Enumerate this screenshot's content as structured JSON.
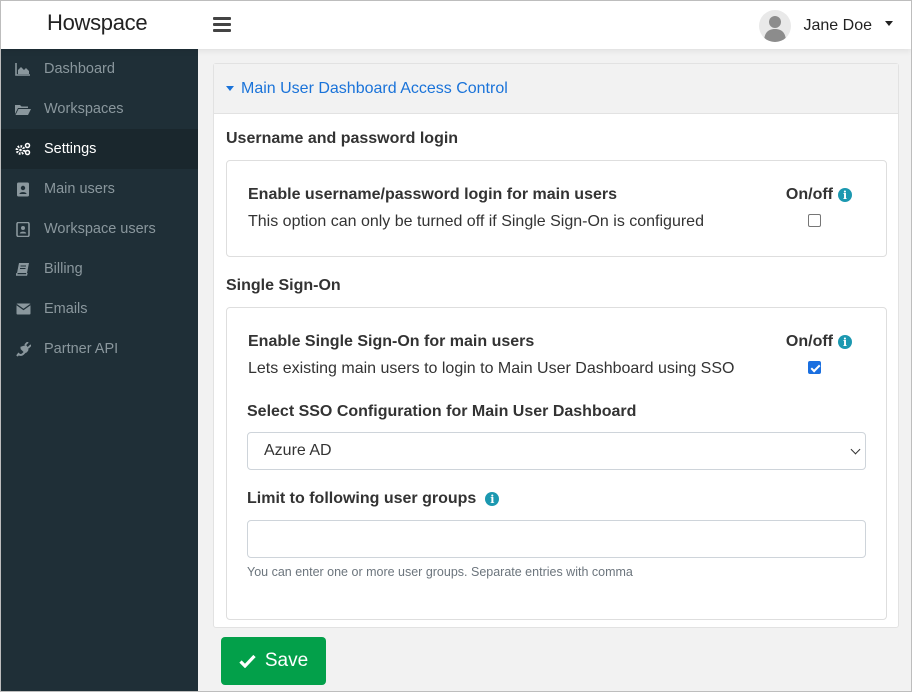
{
  "app": {
    "logo": "Howspace"
  },
  "header": {
    "user_name": "Jane Doe"
  },
  "sidebar": {
    "items": [
      {
        "label": "Dashboard",
        "icon": "area-chart-icon",
        "active": false
      },
      {
        "label": "Workspaces",
        "icon": "folder-open-icon",
        "active": false
      },
      {
        "label": "Settings",
        "icon": "cogs-icon",
        "active": true
      },
      {
        "label": "Main users",
        "icon": "address-book-icon",
        "active": false
      },
      {
        "label": "Workspace users",
        "icon": "address-card-icon",
        "active": false
      },
      {
        "label": "Billing",
        "icon": "book-icon",
        "active": false
      },
      {
        "label": "Emails",
        "icon": "envelope-icon",
        "active": false
      },
      {
        "label": "Partner API",
        "icon": "plug-icon",
        "active": false
      }
    ]
  },
  "panel": {
    "title": "Main User Dashboard Access Control",
    "expanded": true,
    "sections": {
      "password": {
        "title": "Username and password login",
        "option_title": "Enable username/password login for main users",
        "option_desc": "This option can only be turned off if Single Sign-On is configured",
        "toggle_label": "On/off",
        "checked": false
      },
      "sso": {
        "title": "Single Sign-On",
        "option_title": "Enable Single Sign-On for main users",
        "option_desc": "Lets existing main users to login to Main User Dashboard using SSO",
        "toggle_label": "On/off",
        "checked": true,
        "select_label": "Select SSO Configuration for Main User Dashboard",
        "select_value": "Azure AD",
        "groups_label": "Limit to following user groups",
        "groups_value": "",
        "groups_placeholder": "",
        "groups_help": "You can enter one or more user groups. Separate entries with comma"
      }
    }
  },
  "footer": {
    "save_label": "Save"
  },
  "colors": {
    "sidebar_bg": "#1f2f37",
    "sidebar_active_bg": "#1a272d",
    "link_blue": "#1a73d9",
    "info_teal": "#1b98b0",
    "save_green": "#03a04a",
    "checkbox_blue": "#1a6fe0"
  }
}
